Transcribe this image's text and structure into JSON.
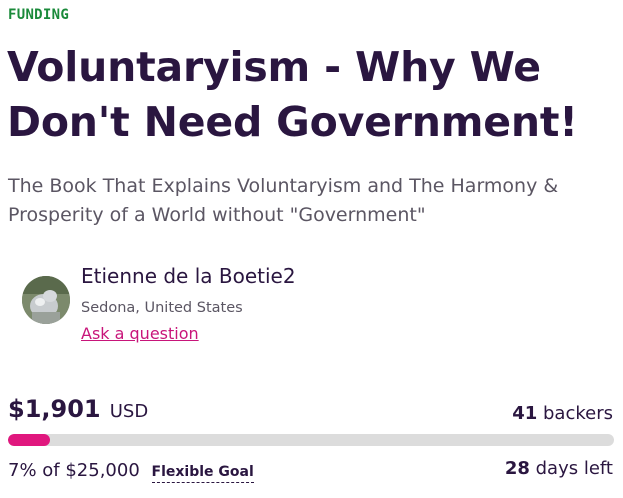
{
  "status_label": "FUNDING",
  "project": {
    "title": "Voluntaryism - Why We Don't Need Government!",
    "subtitle": "The Book That Explains Voluntaryism and The Harmony & Prosperity of a World without \"Government\""
  },
  "creator": {
    "name": "Etienne de la Boetie2",
    "location": "Sedona, United States",
    "ask_link": "Ask a question"
  },
  "funding": {
    "raised": "$1,901",
    "currency": "USD",
    "backers_count": "41",
    "backers_label": "backers",
    "progress_fraction": 0.07,
    "goal_text": "7% of $25,000",
    "goal_type": "Flexible Goal",
    "days_count": "28",
    "days_label": "days left"
  },
  "colors": {
    "status": "#1a8a3a",
    "accent": "#e0177e",
    "link": "#c8157a",
    "title": "#2a1640"
  }
}
